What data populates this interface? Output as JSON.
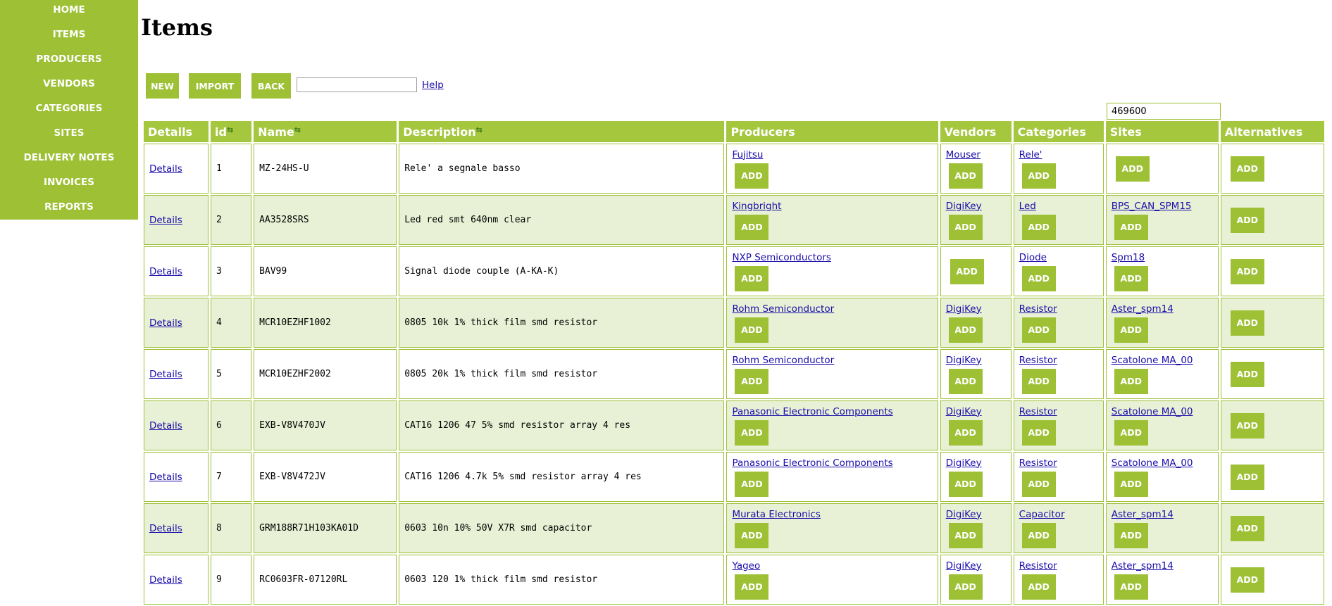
{
  "nav": [
    "HOME",
    "ITEMS",
    "PRODUCERS",
    "VENDORS",
    "CATEGORIES",
    "SITES",
    "DELIVERY NOTES",
    "INVOICES",
    "REPORTS"
  ],
  "title": "Items",
  "toolbar": {
    "new_label": "NEW",
    "import_label": "IMPORT",
    "back_label": "BACK",
    "search_value": "",
    "help_label": "Help",
    "sites_filter_value": "469600"
  },
  "columns": [
    "Details",
    "id",
    "Name",
    "Description",
    "Producers",
    "Vendors",
    "Categories",
    "Sites",
    "Alternatives"
  ],
  "sortable_columns": [
    "id",
    "Name",
    "Description"
  ],
  "add_label": "ADD",
  "details_label": "Details",
  "rows": [
    {
      "id": "1",
      "name": "MZ-24HS-U",
      "description": "Rele' a segnale basso",
      "producer": "Fujitsu",
      "vendor": "Mouser",
      "category": "Rele'",
      "site": ""
    },
    {
      "id": "2",
      "name": "AA3528SRS",
      "description": "Led red smt 640nm clear",
      "producer": "Kingbright",
      "vendor": "DigiKey",
      "category": "Led",
      "site": "BPS_CAN_SPM15"
    },
    {
      "id": "3",
      "name": "BAV99",
      "description": "Signal diode couple (A-KA-K)",
      "producer": "NXP Semiconductors",
      "vendor": "",
      "category": "Diode",
      "site": "Spm18"
    },
    {
      "id": "4",
      "name": "MCR10EZHF1002",
      "description": "0805 10k 1% thick film smd resistor",
      "producer": "Rohm Semiconductor",
      "vendor": "DigiKey",
      "category": "Resistor",
      "site": "Aster_spm14"
    },
    {
      "id": "5",
      "name": "MCR10EZHF2002",
      "description": "0805 20k 1% thick film smd resistor",
      "producer": "Rohm Semiconductor",
      "vendor": "DigiKey",
      "category": "Resistor",
      "site": "Scatolone MA_00"
    },
    {
      "id": "6",
      "name": "EXB-V8V470JV",
      "description": "CAT16 1206 47 5% smd resistor array 4 res",
      "producer": "Panasonic Electronic Components",
      "vendor": "DigiKey",
      "category": "Resistor",
      "site": "Scatolone MA_00"
    },
    {
      "id": "7",
      "name": "EXB-V8V472JV",
      "description": "CAT16 1206 4.7k 5% smd resistor array 4 res",
      "producer": "Panasonic Electronic Components",
      "vendor": "DigiKey",
      "category": "Resistor",
      "site": "Scatolone MA_00"
    },
    {
      "id": "8",
      "name": "GRM188R71H103KA01D",
      "description": "0603 10n 10% 50V X7R smd capacitor",
      "producer": "Murata Electronics",
      "vendor": "DigiKey",
      "category": "Capacitor",
      "site": "Aster_spm14"
    },
    {
      "id": "9",
      "name": "RC0603FR-07120RL",
      "description": "0603 120 1% thick film smd resistor",
      "producer": "Yageo",
      "vendor": "DigiKey",
      "category": "Resistor",
      "site": "Aster_spm14"
    }
  ],
  "colors": {
    "accent": "#9dc034",
    "header": "#a4c73e",
    "row_alt": "#e8f1d5",
    "link": "#1a0dab"
  }
}
